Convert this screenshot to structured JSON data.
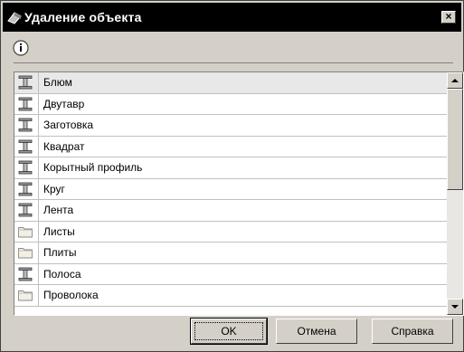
{
  "window": {
    "title": "Удаление объекта",
    "close_label": "×"
  },
  "toolbar": {
    "info_icon": "info-icon"
  },
  "list": {
    "items": [
      {
        "label": "Блюм",
        "icon": "i-beam-icon"
      },
      {
        "label": "Двутавр",
        "icon": "i-beam-icon"
      },
      {
        "label": "Заготовка",
        "icon": "i-beam-icon"
      },
      {
        "label": "Квадрат",
        "icon": "i-beam-icon"
      },
      {
        "label": "Корытный профиль",
        "icon": "i-beam-icon"
      },
      {
        "label": "Круг",
        "icon": "i-beam-icon"
      },
      {
        "label": "Лента",
        "icon": "i-beam-icon"
      },
      {
        "label": "Листы",
        "icon": "folder-icon"
      },
      {
        "label": "Плиты",
        "icon": "folder-icon"
      },
      {
        "label": "Полоса",
        "icon": "i-beam-icon"
      },
      {
        "label": "Проволока",
        "icon": "folder-icon"
      }
    ]
  },
  "buttons": {
    "ok": "OK",
    "cancel": "Отмена",
    "help": "Справка"
  }
}
